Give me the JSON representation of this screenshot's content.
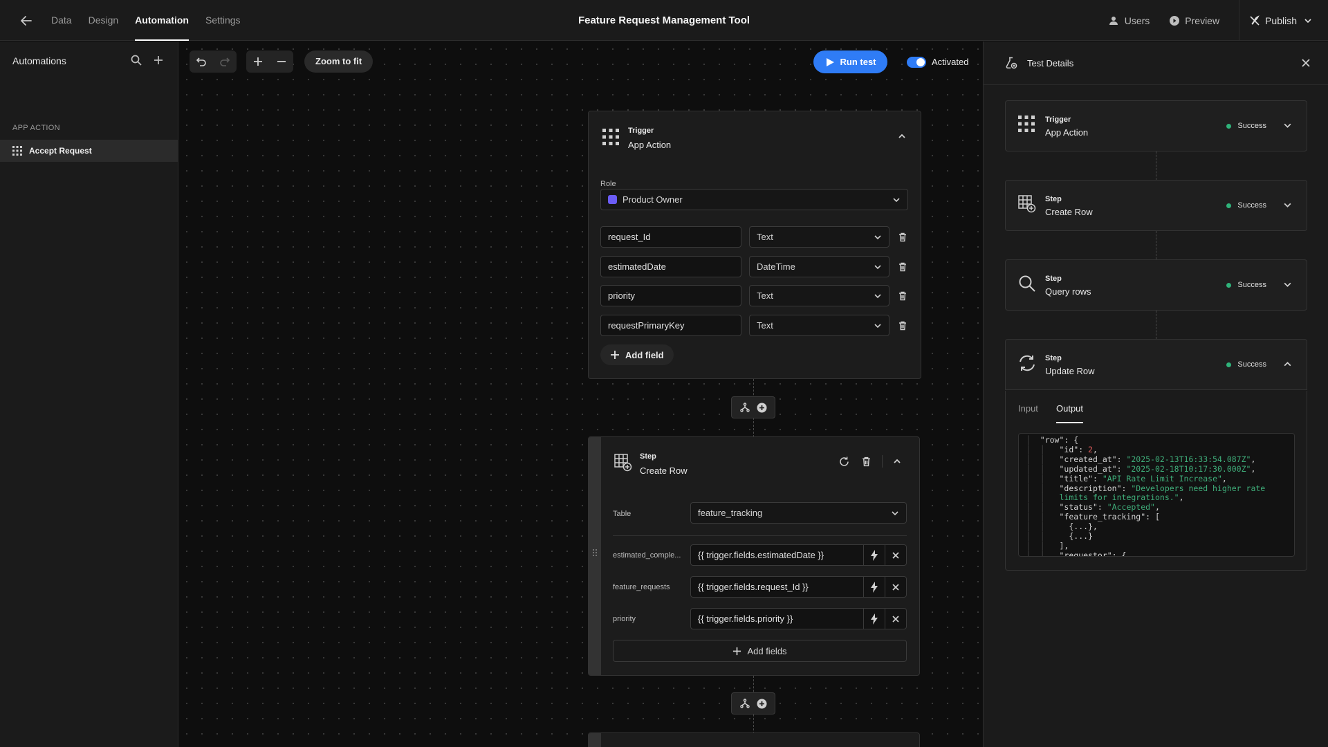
{
  "header": {
    "nav": [
      "Data",
      "Design",
      "Automation",
      "Settings"
    ],
    "active_tab": "Automation",
    "title": "Feature Request Management Tool",
    "users_label": "Users",
    "preview_label": "Preview",
    "publish_label": "Publish"
  },
  "sidebar": {
    "title": "Automations",
    "section": "APP ACTION",
    "item": "Accept Request"
  },
  "toolbar": {
    "zoom_fit": "Zoom to fit",
    "run_test": "Run test",
    "activated": "Activated",
    "activated_on": true
  },
  "trigger": {
    "kind": "Trigger",
    "name": "App Action",
    "role_label": "Role",
    "role_value": "Product Owner",
    "role_color": "#6b5cf6",
    "fields": [
      {
        "name": "request_Id",
        "type": "Text"
      },
      {
        "name": "estimatedDate",
        "type": "DateTime"
      },
      {
        "name": "priority",
        "type": "Text"
      },
      {
        "name": "requestPrimaryKey",
        "type": "Text"
      }
    ],
    "add_field": "Add field"
  },
  "step": {
    "kind": "Step",
    "name": "Create Row",
    "table_label": "Table",
    "table_value": "feature_tracking",
    "mappings": [
      {
        "label": "estimated_comple...",
        "value": "{{ trigger.fields.estimatedDate }}"
      },
      {
        "label": "feature_requests",
        "value": "{{ trigger.fields.request_Id }}"
      },
      {
        "label": "priority",
        "value": "{{ trigger.fields.priority }}"
      }
    ],
    "add_fields": "Add fields"
  },
  "test_panel": {
    "title": "Test Details",
    "cards": [
      {
        "kind": "Trigger",
        "name": "App Action",
        "status": "Success",
        "icon": "grid-icon"
      },
      {
        "kind": "Step",
        "name": "Create Row",
        "status": "Success",
        "icon": "table-add-icon"
      },
      {
        "kind": "Step",
        "name": "Query rows",
        "status": "Success",
        "icon": "search-icon"
      },
      {
        "kind": "Step",
        "name": "Update Row",
        "status": "Success",
        "icon": "refresh-icon"
      }
    ],
    "status_color": "#2fb37a",
    "tabs": [
      "Input",
      "Output"
    ],
    "active_tab": "Output",
    "output_lines": [
      "\"row\": {",
      "  \"id\": 2,",
      "  \"created_at\": \"2025-02-13T16:33:54.087Z\",",
      "  \"updated_at\": \"2025-02-18T10:17:30.000Z\",",
      "  \"title\": \"API Rate Limit Increase\",",
      "  \"description\": \"Developers need higher rate",
      "  limits for integrations.\",",
      "  \"status\": \"Accepted\",",
      "  \"feature_tracking\": [",
      "    {...},",
      "    {...}",
      "  ],",
      "  \"requestor\": {"
    ]
  },
  "colors": {
    "accent": "#2f7cf6",
    "success": "#2fb37a"
  }
}
